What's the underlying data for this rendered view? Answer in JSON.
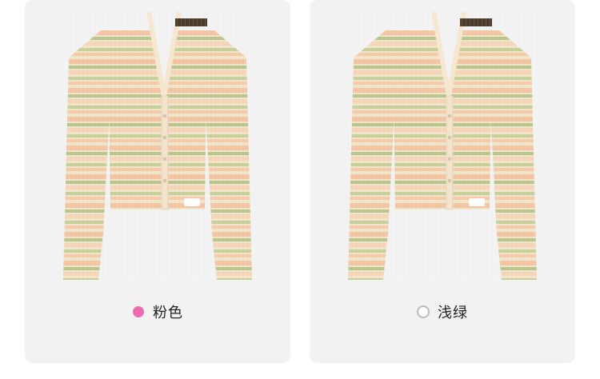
{
  "options": [
    {
      "label": "粉色",
      "selected": true,
      "dot_color": "#f06ab0"
    },
    {
      "label": "浅绿",
      "selected": false,
      "dot_color": "#ffffff"
    }
  ],
  "colors": {
    "background": "#ffffff",
    "card": "#f2f2f2",
    "knit_peach": "#f2c4a1",
    "knit_green": "#b8c48a",
    "knit_cream": "#efe4c8"
  },
  "icons": {
    "selected": "radio-selected-icon",
    "unselected": "radio-unselected-icon"
  }
}
